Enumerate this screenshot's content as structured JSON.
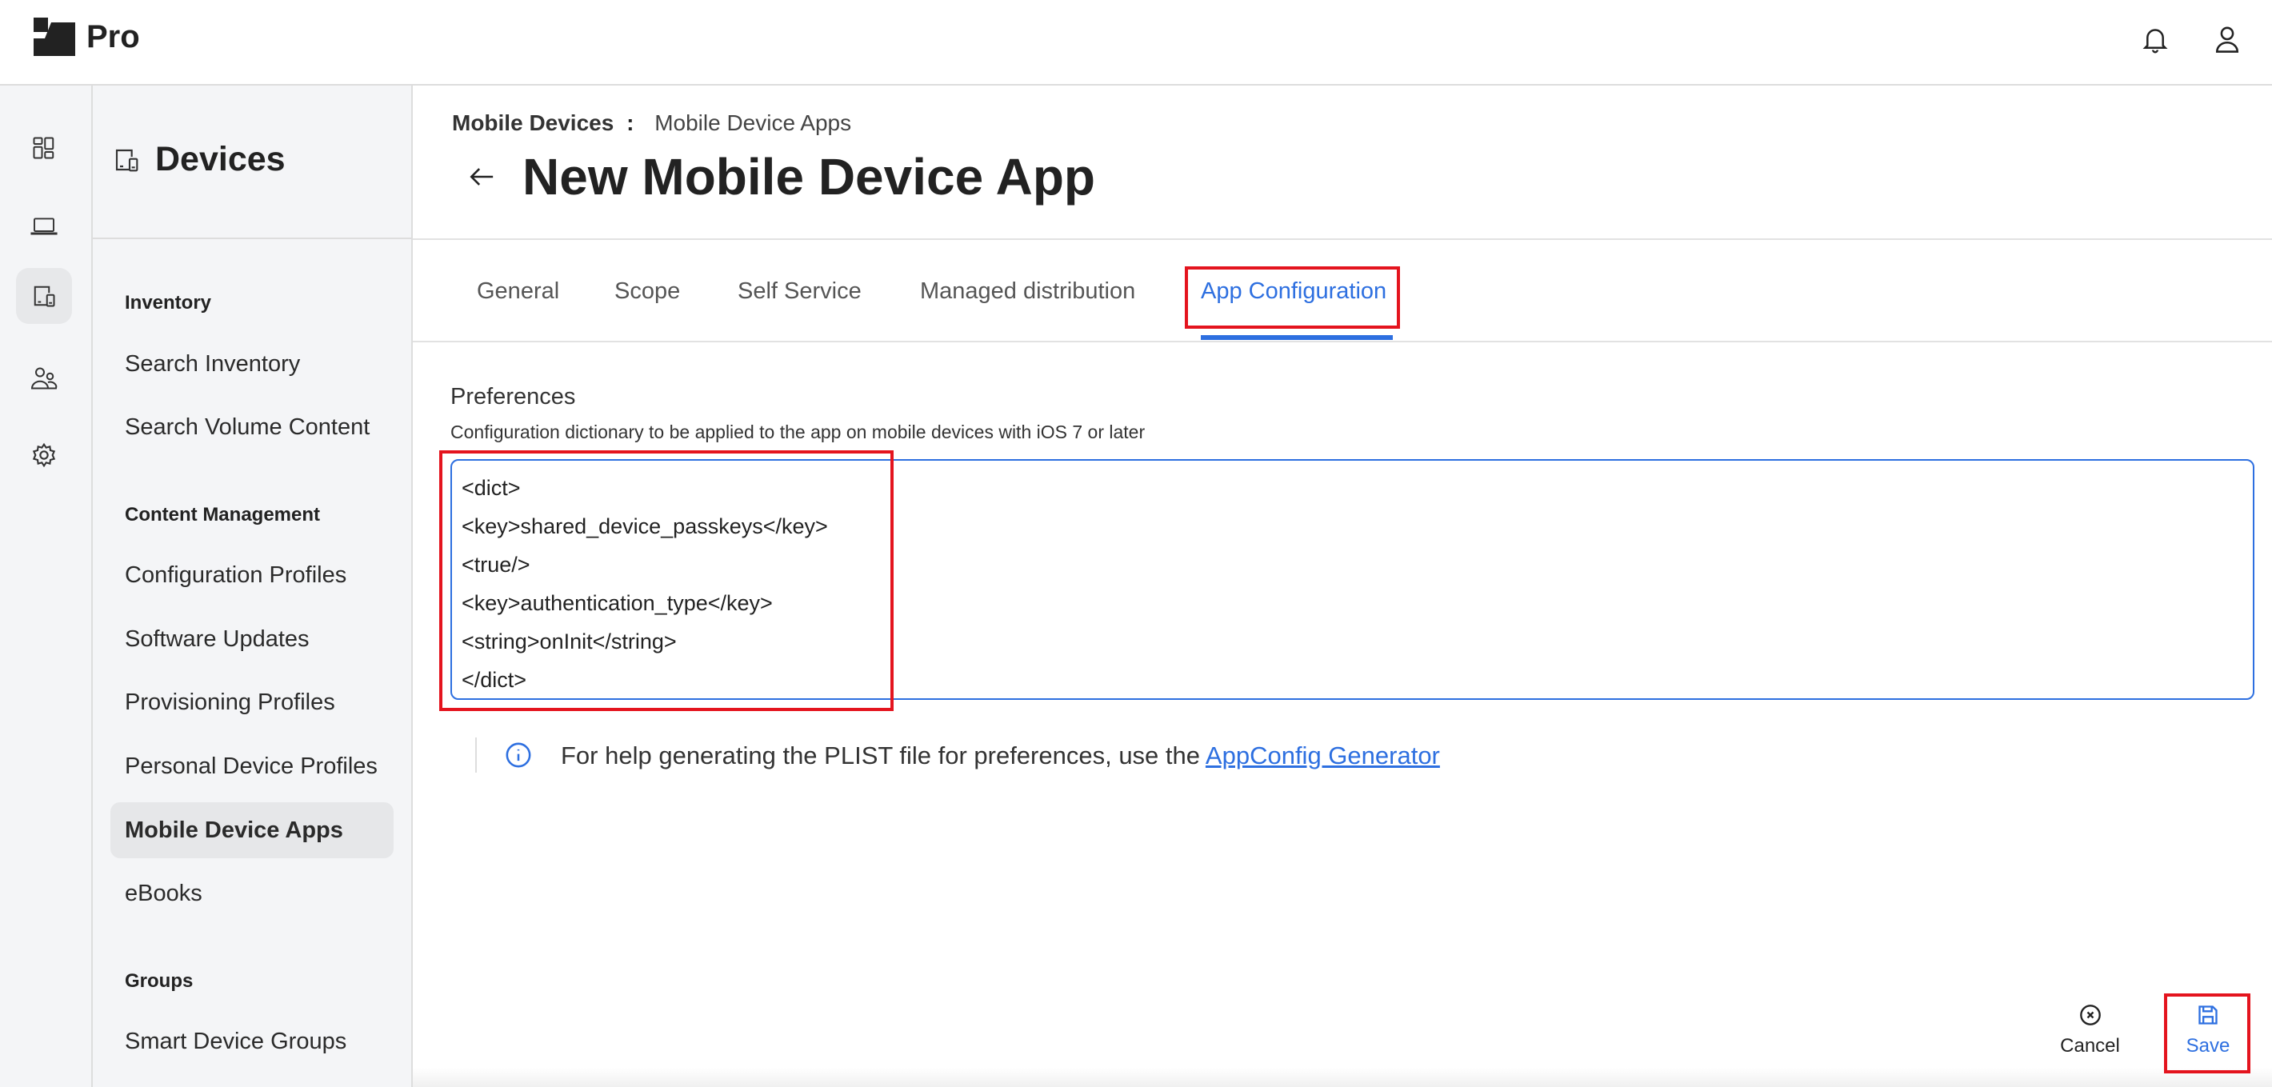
{
  "header": {
    "brand": "Pro",
    "icons": [
      "bell-icon",
      "user-icon"
    ]
  },
  "rail": {
    "items": [
      "dashboard-icon",
      "computer-icon",
      "devices-icon",
      "users-icon",
      "settings-icon"
    ],
    "active": "devices-icon"
  },
  "sidebar": {
    "title": "Devices",
    "sections": [
      {
        "label": "Inventory",
        "items": [
          "Search Inventory",
          "Search Volume Content"
        ]
      },
      {
        "label": "Content Management",
        "items": [
          "Configuration Profiles",
          "Software Updates",
          "Provisioning Profiles",
          "Personal Device Profiles",
          "Mobile Device Apps",
          "eBooks"
        ]
      },
      {
        "label": "Groups",
        "items": [
          "Smart Device Groups"
        ]
      }
    ],
    "active": "Mobile Device Apps"
  },
  "breadcrumb": {
    "parent": "Mobile Devices",
    "sep": ":",
    "current": "Mobile Device Apps"
  },
  "page_title": "New Mobile Device App",
  "tabs": [
    "General",
    "Scope",
    "Self Service",
    "Managed distribution",
    "App Configuration"
  ],
  "active_tab": "App Configuration",
  "preferences": {
    "label": "Preferences",
    "description": "Configuration dictionary to be applied to the app on mobile devices with iOS 7 or later",
    "lines": [
      "<dict>",
      "<key>shared_device_passkeys</key>",
      "<true/>",
      "<key>authentication_type</key>",
      "<string>onInit</string>",
      "</dict>"
    ]
  },
  "info": {
    "text": "For help generating the PLIST file for preferences, use the ",
    "link": "AppConfig Generator"
  },
  "footer": {
    "cancel": "Cancel",
    "save": "Save"
  },
  "colors": {
    "accent": "#2d6fe0",
    "highlight": "#e4141e"
  }
}
